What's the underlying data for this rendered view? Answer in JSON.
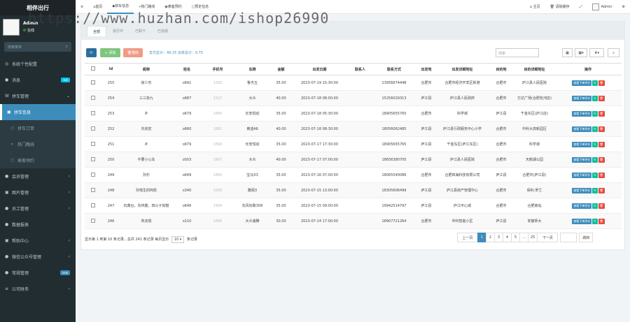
{
  "app": {
    "title": "相伴出行",
    "user_name": "Admin",
    "user_status": "在线",
    "search_placeholder": "搜索菜单"
  },
  "menu": [
    {
      "icon": "◎",
      "label": "系统个性配置",
      "type": "top"
    },
    {
      "icon": "●",
      "label": "消息",
      "badge": "hot",
      "badge_color": "#00c0ef",
      "type": "top"
    },
    {
      "icon": "W",
      "label": "拼车管理",
      "caret": "⌄",
      "type": "top"
    },
    {
      "icon": "▣",
      "label": "拼车信息",
      "type": "active"
    },
    {
      "icon": "○",
      "label": "拼车订单",
      "type": "sub"
    },
    {
      "icon": "»",
      "label": "热门路线",
      "type": "sub"
    },
    {
      "icon": "○",
      "label": "乘客预约",
      "type": "sub"
    },
    {
      "icon": "●",
      "label": "会员管理",
      "caret": "‹",
      "type": "top"
    },
    {
      "icon": "▣",
      "label": "图片管理",
      "caret": "‹",
      "type": "top"
    },
    {
      "icon": "●",
      "label": "员工管理",
      "caret": "‹",
      "type": "top"
    },
    {
      "icon": "●",
      "label": "数据报表",
      "type": "top"
    },
    {
      "icon": "▣",
      "label": "帮助中心",
      "caret": "‹",
      "type": "top"
    },
    {
      "icon": "●",
      "label": "微信公众号管理",
      "caret": "‹",
      "type": "top"
    },
    {
      "icon": "●",
      "label": "常规管理",
      "badge": "new",
      "badge_color": "#3c8dbc",
      "type": "top"
    },
    {
      "icon": "≡",
      "label": "公司财务",
      "caret": "‹",
      "type": "top"
    }
  ],
  "topbar": {
    "menu_icon": "≡",
    "tabs": [
      {
        "icon": "⌂",
        "label": "首页"
      },
      {
        "icon": "◆",
        "label": "拼车信息",
        "active": true
      },
      {
        "icon": "»",
        "label": "热门路线"
      },
      {
        "icon": "◉",
        "label": "乘客预约"
      },
      {
        "icon": "○",
        "label": "预定信息"
      }
    ],
    "right": {
      "home": "主页",
      "clear": "清除缓存",
      "expand_icon": "⤢",
      "user": "Admin",
      "gear_icon": "⚙"
    }
  },
  "watermark": "https://www.huzhan.com/ishop26990",
  "subtabs": [
    "全部",
    "进行中",
    "已取下",
    "已完成"
  ],
  "toolbar": {
    "refresh_icon": "⟳",
    "add_label": "添加",
    "delete_label": "删除",
    "stats": "支付总计：49.25 派单总计：0.75",
    "search_placeholder": "搜索",
    "view_icon": "▦",
    "columns_icon": "▦▾",
    "export_icon": "⬆▾",
    "search_icon": "⌕",
    "colors": {
      "refresh": "#2b6e9c",
      "add": "#7ec67e",
      "delete": "#f39a86"
    }
  },
  "table": {
    "headers": [
      "",
      "Id",
      "昵称",
      "姓名",
      "手机号",
      "车牌",
      "金额",
      "出发日期",
      "联系人",
      "联系方式",
      "出发地",
      "出发详细地址",
      "目的地",
      "目的详细地址",
      "操作"
    ],
    "rows": [
      [
        "255",
        "徐少杰",
        "o691",
        "1395",
        "鲁杰五",
        "35.00",
        "2023-07-19 15:30:00",
        "",
        "13956674448",
        "合肥市",
        "合肥市经济开发区新港",
        "合肥市",
        "庐江县人民医院"
      ],
      [
        "254",
        "三三抢九",
        "o687",
        "1527",
        "大众",
        "40.00",
        "2023-07-18 08:00:00",
        "",
        "15256029313",
        "庐江县",
        "庐江县人民政府",
        "合肥市",
        "万达广场(合肥包河店)"
      ],
      [
        "253",
        "乡",
        "o679",
        "1890",
        "长安悦动",
        "35.00",
        "2023-07-18 05:30:00",
        "",
        "18905655765",
        "合肥市",
        "科学城",
        "庐江县",
        "千金东区(庐江店)"
      ],
      [
        "252",
        "刘兆宏",
        "o660",
        "1861",
        "奥迪A6",
        "40.00",
        "2023-07-18 08:30:00",
        "",
        "18056062485",
        "庐江县",
        "庐江县行政服务中心小学",
        "合肥市",
        "中科大高新园区"
      ],
      [
        "251",
        "乡",
        "o679",
        "1890",
        "长安悦动",
        "35.00",
        "2023-07-17 17:30:00",
        "",
        "18905655765",
        "庐江县",
        "千金东区(庐江东区)",
        "合肥市",
        "科学城"
      ],
      [
        "250",
        "不要小心车",
        "o503",
        "1867",
        "大众",
        "40.00",
        "2023-07-17 07:00:00",
        "",
        "18656380705",
        "庐江县",
        "庐江县人民医院",
        "合肥市",
        "天鹅湖公园"
      ],
      [
        "249",
        "孙杉",
        "o649",
        "1865",
        "宝马X3",
        "35.00",
        "2023-07-16 07:00:00",
        "",
        "18065540086",
        "合肥市",
        "合肥四海科技有限公司",
        "庐江县",
        "合肥市(庐江县)"
      ],
      [
        "248",
        "孙栈生的阿凯",
        "o340",
        "1830",
        "雅阁3",
        "35.00",
        "2023-07-15 13:00:00",
        "",
        "18305606499",
        "庐江县",
        "庐江县房产管理中心",
        "合肥市",
        "保利·罗兰"
      ],
      [
        "247",
        "石典台，东林鑫，四公子如鼓",
        "o646",
        "1994",
        "东风标致308",
        "35.00",
        "2023-07-15 09:00:00",
        "",
        "19942514797",
        "庐江县",
        "庐江中心城",
        "合肥市",
        "合肥南站"
      ],
      [
        "246",
        "朱兆璟",
        "o110",
        "1890",
        "大众速腾",
        "30.00",
        "2023-07-14 17:00:00",
        "",
        "18907721264",
        "合肥市",
        "中科智能小区",
        "庐江县",
        "安徽师大"
      ]
    ],
    "action_label": "查看下单评价",
    "edit_icon": "✎",
    "delete_icon": "🗑"
  },
  "footer": {
    "prefix": "显示第 1 到第 10 条记录，总共 241 条记录 每页显示",
    "page_size": "10",
    "suffix": "条记录"
  },
  "pager": [
    "上一页",
    "1",
    "2",
    "3",
    "4",
    "5",
    "...",
    "25",
    "下一页",
    "",
    "跳转"
  ]
}
